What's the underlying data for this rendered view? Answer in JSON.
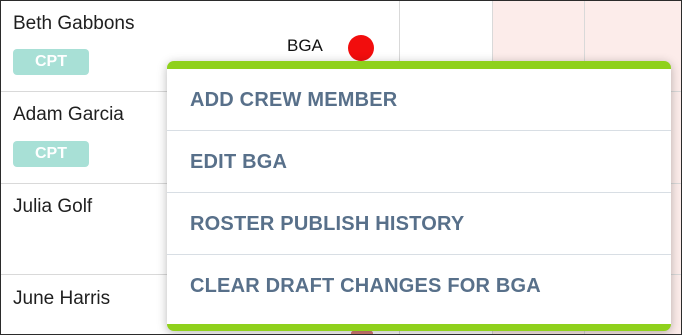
{
  "crew": [
    {
      "name": "Beth Gabbons",
      "badge": "CPT",
      "code": "BGA"
    },
    {
      "name": "Adam Garcia",
      "badge": "CPT"
    },
    {
      "name": "Julia Golf"
    },
    {
      "name": "June Harris"
    }
  ],
  "context_menu": {
    "items": [
      "ADD CREW MEMBER",
      "EDIT BGA",
      "ROSTER PUBLISH HISTORY",
      "CLEAR DRAFT CHANGES FOR BGA"
    ]
  },
  "colors": {
    "menu_accent": "#8fd11c",
    "menu_text": "#58708a",
    "badge_bg": "#a8e0d6",
    "status_dot": "#f20d0d",
    "duty_cell": "#fcecea"
  },
  "icons": {
    "status": "red-dot-icon"
  }
}
